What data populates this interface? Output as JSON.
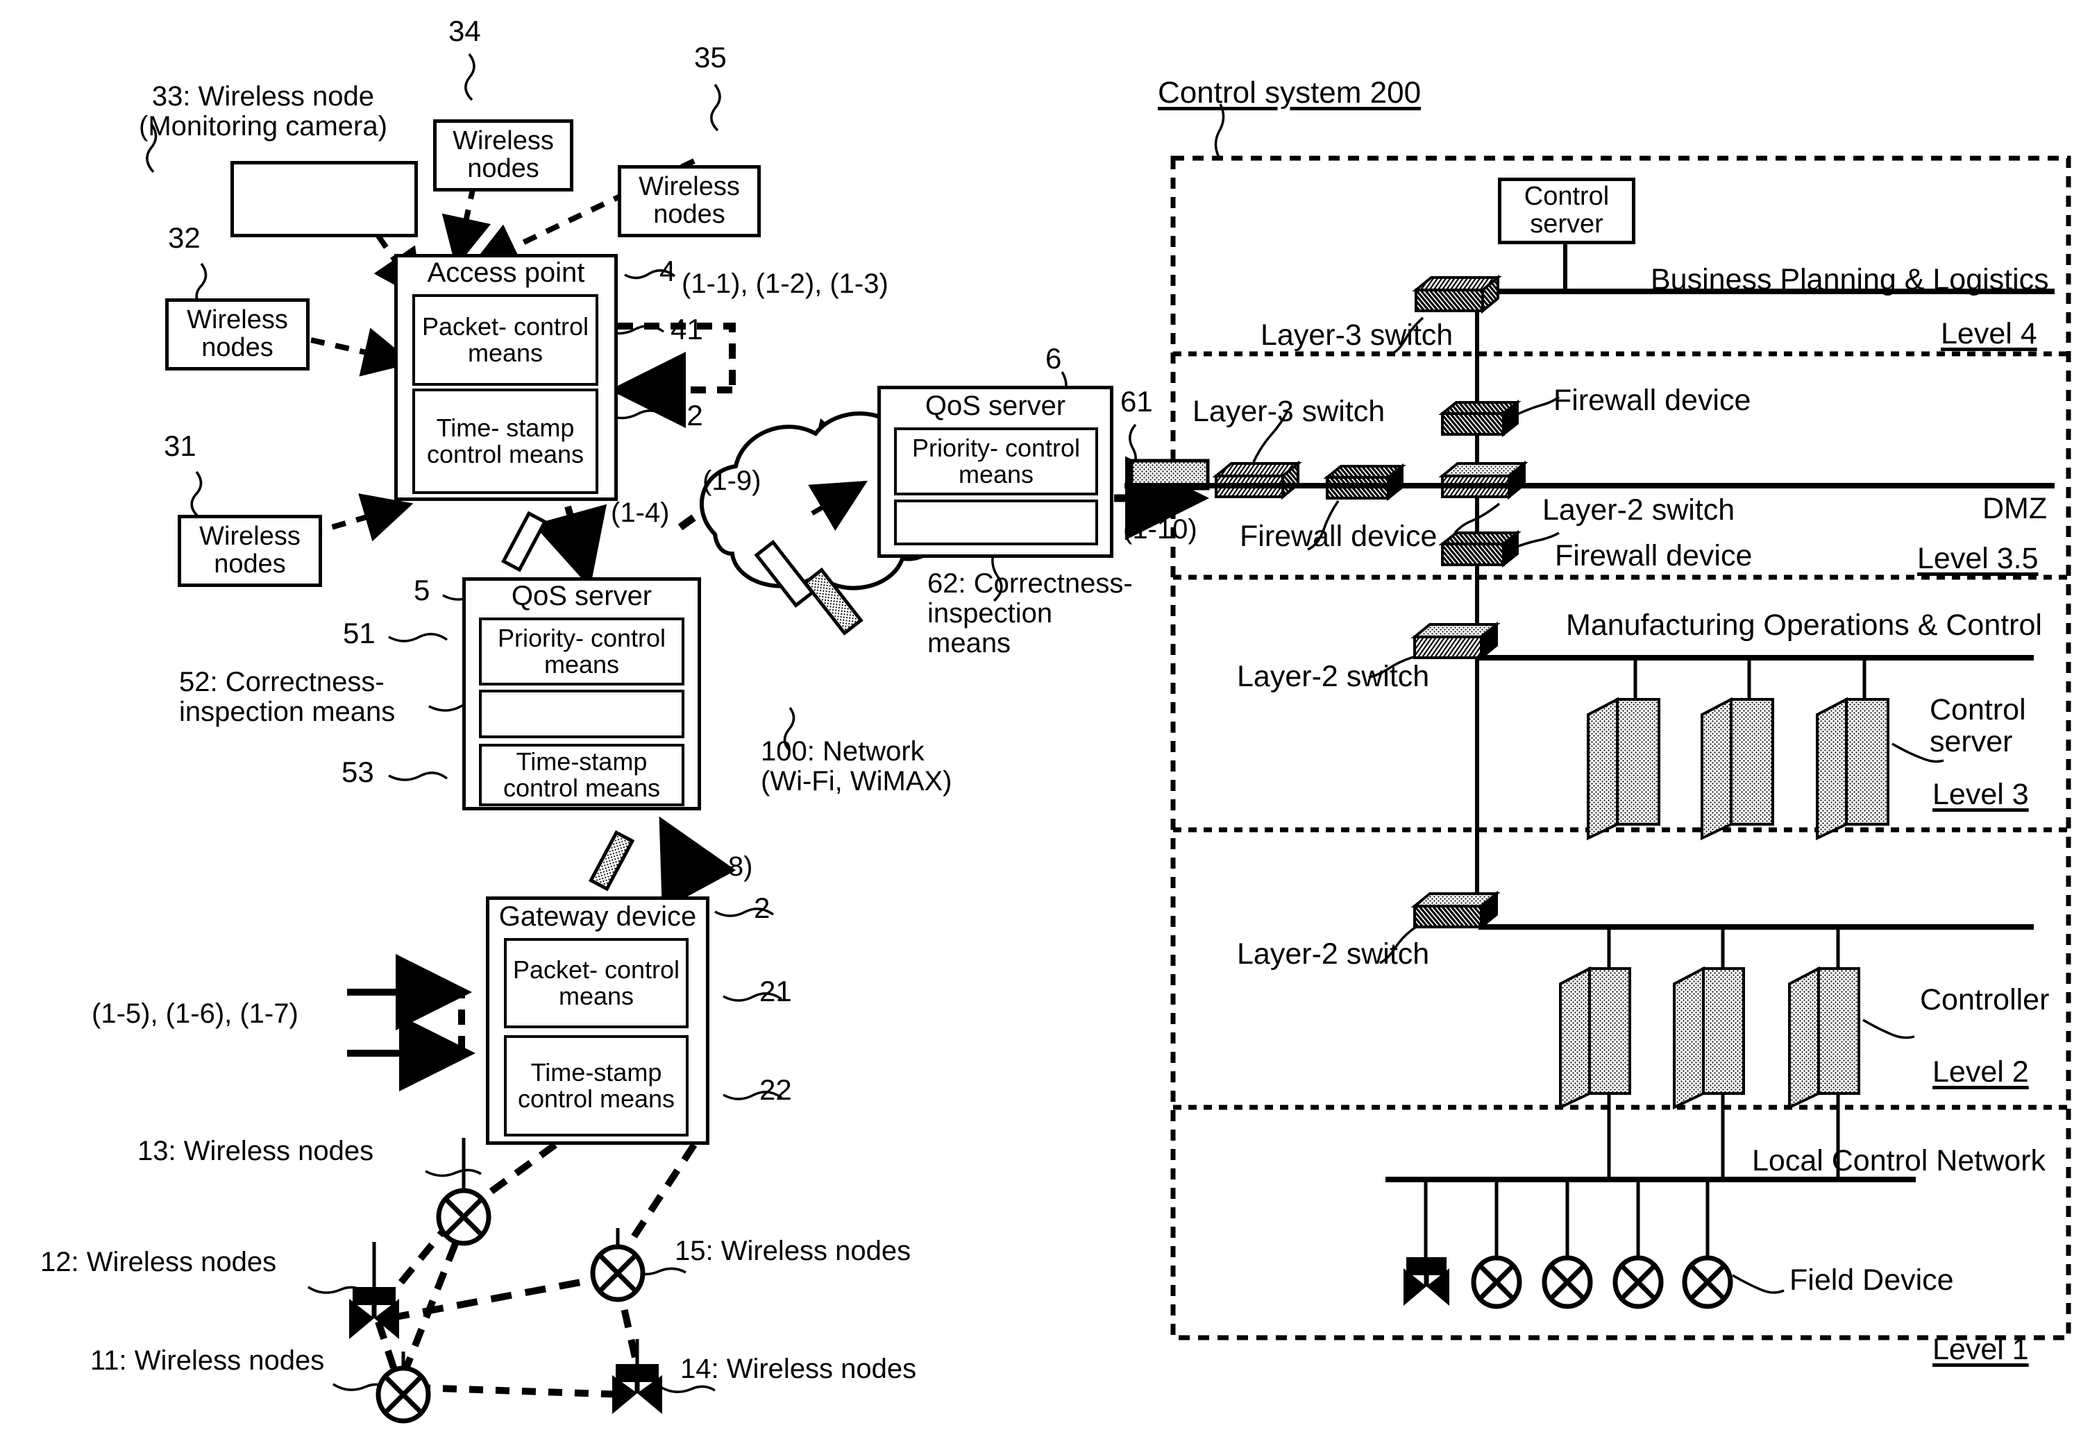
{
  "figure": {
    "left_section": {
      "node_33_label": "33: Wireless node\n(Monitoring camera)",
      "node_32_ref": "32",
      "node_31_ref": "31",
      "node_34_ref": "34",
      "node_35_ref": "35",
      "wireless_nodes_label": "Wireless\nnodes",
      "access_point": {
        "title": "Access point",
        "ref": "4",
        "packet_control": "Packet-\ncontrol\nmeans",
        "packet_control_ref": "41",
        "timestamp_control": "Time-\nstamp\ncontrol\nmeans",
        "timestamp_control_ref": "42"
      },
      "flow_123": "(1-1), (1-2), (1-3)",
      "flow_14": "(1-4)",
      "flow_19": "(1-9)",
      "flow_110": "(1-10)",
      "flow_18": "(1-8)",
      "flow_567": "(1-5), (1-6), (1-7)",
      "qos_server_5": {
        "ref": "5",
        "title": "QoS server",
        "priority_control": "Priority-\ncontrol means",
        "priority_control_ref": "51",
        "correctness_label": "52: Correctness-\ninspection means",
        "timestamp_control": "Time-stamp\ncontrol means",
        "timestamp_control_ref": "53"
      },
      "qos_server_6": {
        "ref": "6",
        "title": "QoS server",
        "priority_control": "Priority-\ncontrol means",
        "priority_control_ref": "61",
        "correctness_label": "62: Correctness-\ninspection\nmeans"
      },
      "network_cloud": "100: Network\n(Wi-Fi, WiMAX)",
      "gateway_device": {
        "title": "Gateway device",
        "ref": "2",
        "packet_control": "Packet-\ncontrol\nmeans",
        "packet_control_ref": "21",
        "timestamp_control": "Time-stamp\ncontrol\nmeans",
        "timestamp_control_ref": "22"
      },
      "mesh_nodes": [
        {
          "ref": "13: Wireless nodes"
        },
        {
          "ref": "12: Wireless nodes"
        },
        {
          "ref": "15: Wireless nodes"
        },
        {
          "ref": "11: Wireless nodes"
        },
        {
          "ref": "14: Wireless nodes"
        }
      ]
    },
    "right_section": {
      "system_title": "Control system 200",
      "level4": {
        "name": "Level 4",
        "zone_label": "Business Planning & Logistics",
        "control_server": "Control\nserver",
        "layer3_switch": "Layer-3 switch"
      },
      "dmz": {
        "name": "Level 3.5",
        "zone_label": "DMZ",
        "layer3_switch": "Layer-3 switch",
        "layer2_switch": "Layer-2 switch",
        "firewall_top": "Firewall device",
        "firewall_mid": "Firewall device",
        "firewall_bottom": "Firewall device"
      },
      "level3": {
        "name": "Level 3",
        "zone_label": "Manufacturing Operations & Control",
        "layer2_switch": "Layer-2 switch",
        "control_server": "Control\nserver",
        "server_count": 3
      },
      "level2": {
        "name": "Level 2",
        "layer2_switch": "Layer-2 switch",
        "controller": "Controller",
        "controller_count": 3
      },
      "level1": {
        "name": "Level 1",
        "zone_label": "Local Control Network",
        "field_device": "Field Device",
        "device_count": 5
      }
    }
  }
}
